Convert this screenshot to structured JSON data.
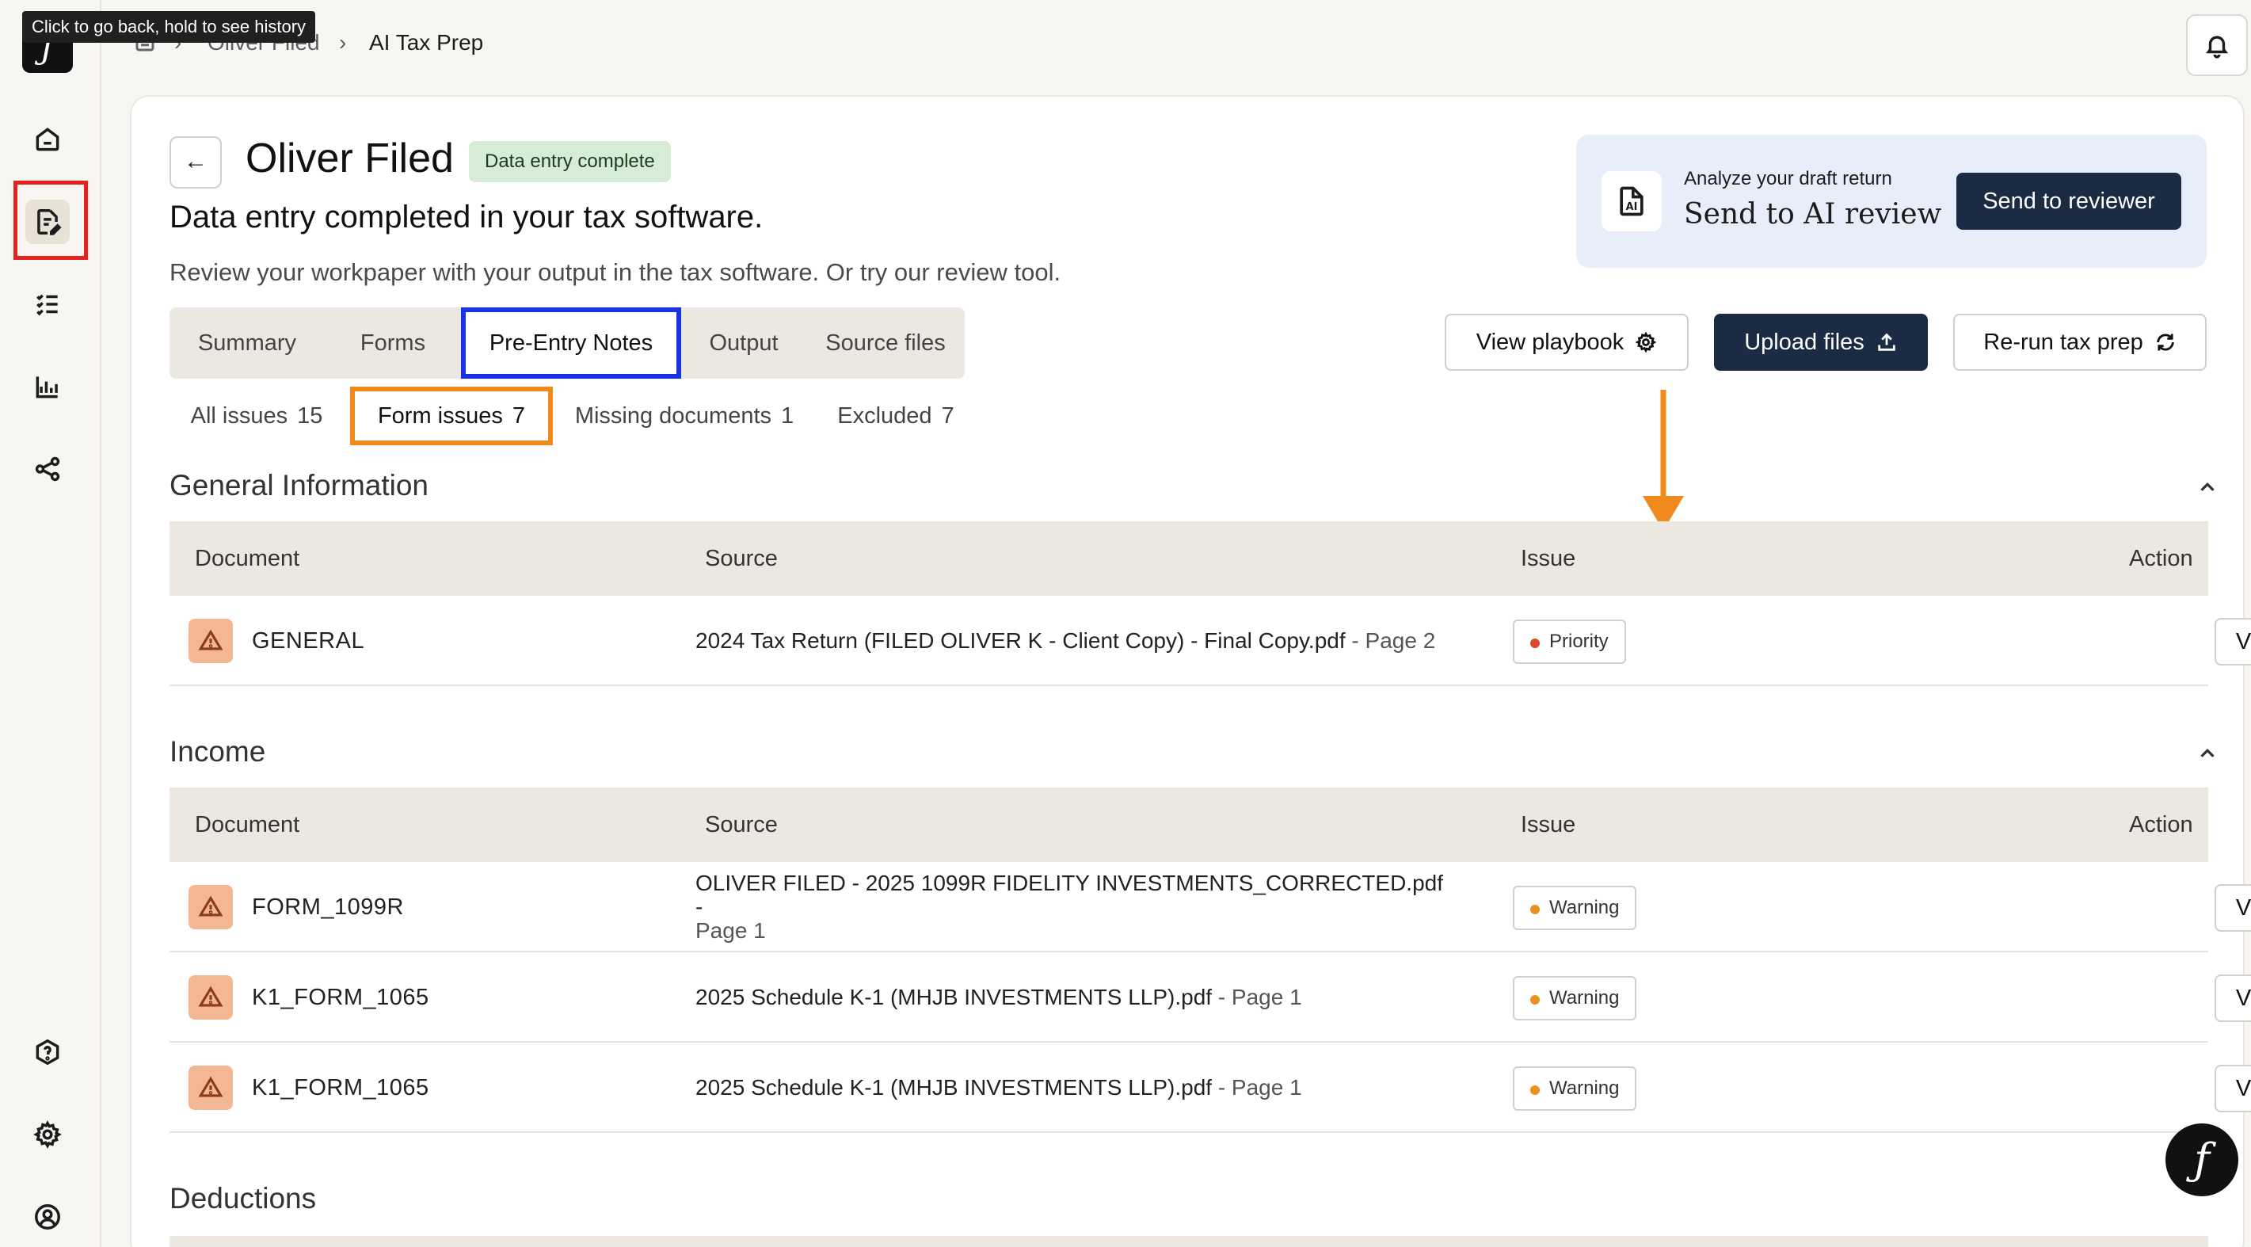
{
  "tooltip": "Click to go back, hold to see history",
  "breadcrumb": {
    "client": "Oliver Filed",
    "page": "AI Tax Prep",
    "sep": "›"
  },
  "header": {
    "back_glyph": "←",
    "client_name": "Oliver Filed",
    "status": "Data entry complete",
    "subtitle": "Data entry completed in your tax software.",
    "description": "Review your workpaper with your output in the tax software. Or try our review tool."
  },
  "ai_review": {
    "small": "Analyze your draft return",
    "big": "Send to AI review",
    "button": "Send to reviewer"
  },
  "tabs": [
    "Summary",
    "Forms",
    "Pre-Entry Notes",
    "Output",
    "Source files"
  ],
  "active_tab": "Pre-Entry Notes",
  "toolbar": {
    "view_playbook": "View playbook",
    "upload_files": "Upload files",
    "rerun": "Re-run tax prep"
  },
  "filters": [
    {
      "label": "All issues",
      "count": "15"
    },
    {
      "label": "Form issues",
      "count": "7"
    },
    {
      "label": "Missing documents",
      "count": "1"
    },
    {
      "label": "Excluded",
      "count": "7"
    }
  ],
  "columns": {
    "document": "Document",
    "source": "Source",
    "issue": "Issue",
    "action": "Action"
  },
  "sections": [
    {
      "title": "General Information",
      "rows": [
        {
          "document": "GENERAL",
          "source": "2024 Tax Return (FILED OLIVER K - Client Copy) - Final Copy.pdf",
          "page": " - Page 2",
          "issue": "Priority",
          "action": "View"
        }
      ]
    },
    {
      "title": "Income",
      "rows": [
        {
          "document": "FORM_1099R",
          "source": "OLIVER FILED - 2025 1099R FIDELITY INVESTMENTS_CORRECTED.pdf -",
          "page": "Page 1",
          "issue": "Warning",
          "action": "View"
        },
        {
          "document": "K1_FORM_1065",
          "source": "2025 Schedule K-1 (MHJB INVESTMENTS LLP).pdf",
          "page": " - Page 1",
          "issue": "Warning",
          "action": "View"
        },
        {
          "document": "K1_FORM_1065",
          "source": "2025 Schedule K-1 (MHJB INVESTMENTS LLP).pdf",
          "page": " - Page 1",
          "issue": "Warning",
          "action": "View"
        }
      ]
    },
    {
      "title": "Deductions",
      "rows": []
    }
  ],
  "colors": {
    "priority_dot": "#e0452e",
    "warning_dot": "#e8931f",
    "primary_button": "#1c2b44",
    "tab_highlight": "#1a32e6",
    "filter_highlight": "#f08a1c",
    "sidebar_highlight": "#e3211d"
  },
  "icons": [
    "home-icon",
    "document-edit-icon",
    "checklist-icon",
    "chart-icon",
    "share-icon",
    "help-icon",
    "settings-icon",
    "user-icon",
    "bell-icon",
    "gear-icon",
    "upload-icon",
    "refresh-icon",
    "warning-icon",
    "ai-document-icon",
    "chevron-up-icon"
  ]
}
